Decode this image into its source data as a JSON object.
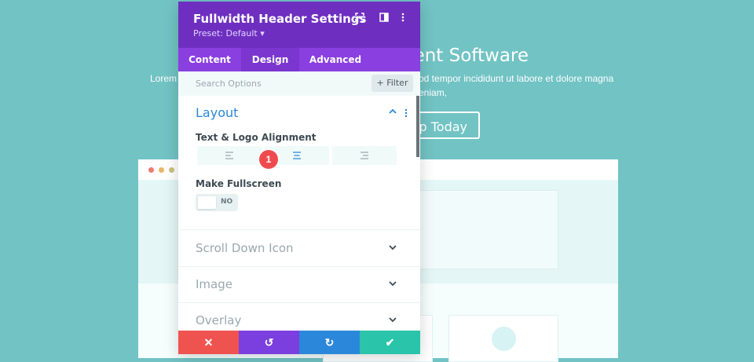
{
  "background": {
    "heading_visible": "nent Software",
    "paragraph_left": "Lorem",
    "paragraph_right": "od tempor incididunt ut labore et dolore magna",
    "paragraph_line2": "eniam,",
    "cta_label": "Up Today"
  },
  "panel": {
    "title": "Fullwidth Header Settings",
    "preset": "Preset: Default ▾",
    "tabs": [
      {
        "label": "Content",
        "active": false
      },
      {
        "label": "Design",
        "active": true
      },
      {
        "label": "Advanced",
        "active": false
      }
    ],
    "search": {
      "placeholder": "Search Options",
      "filter_label": "+ Filter"
    },
    "sections": {
      "layout": {
        "title": "Layout",
        "text_logo_alignment_label": "Text & Logo Alignment",
        "alignment_selected": "center",
        "make_fullscreen_label": "Make Fullscreen",
        "fullscreen_value": "NO"
      },
      "scroll_down_icon": "Scroll Down Icon",
      "image": "Image",
      "overlay": "Overlay"
    },
    "badge": "1",
    "footer": {
      "cancel_color": "#ef5350",
      "undo_color": "#7b3fe0",
      "redo_color": "#2b87da",
      "save_color": "#29c4a9"
    }
  },
  "colors": {
    "accent_purple": "#6e2fc0",
    "tab_purple": "#8a3fe1",
    "accent_blue": "#2b87da",
    "page_bg": "#72c3c4"
  }
}
